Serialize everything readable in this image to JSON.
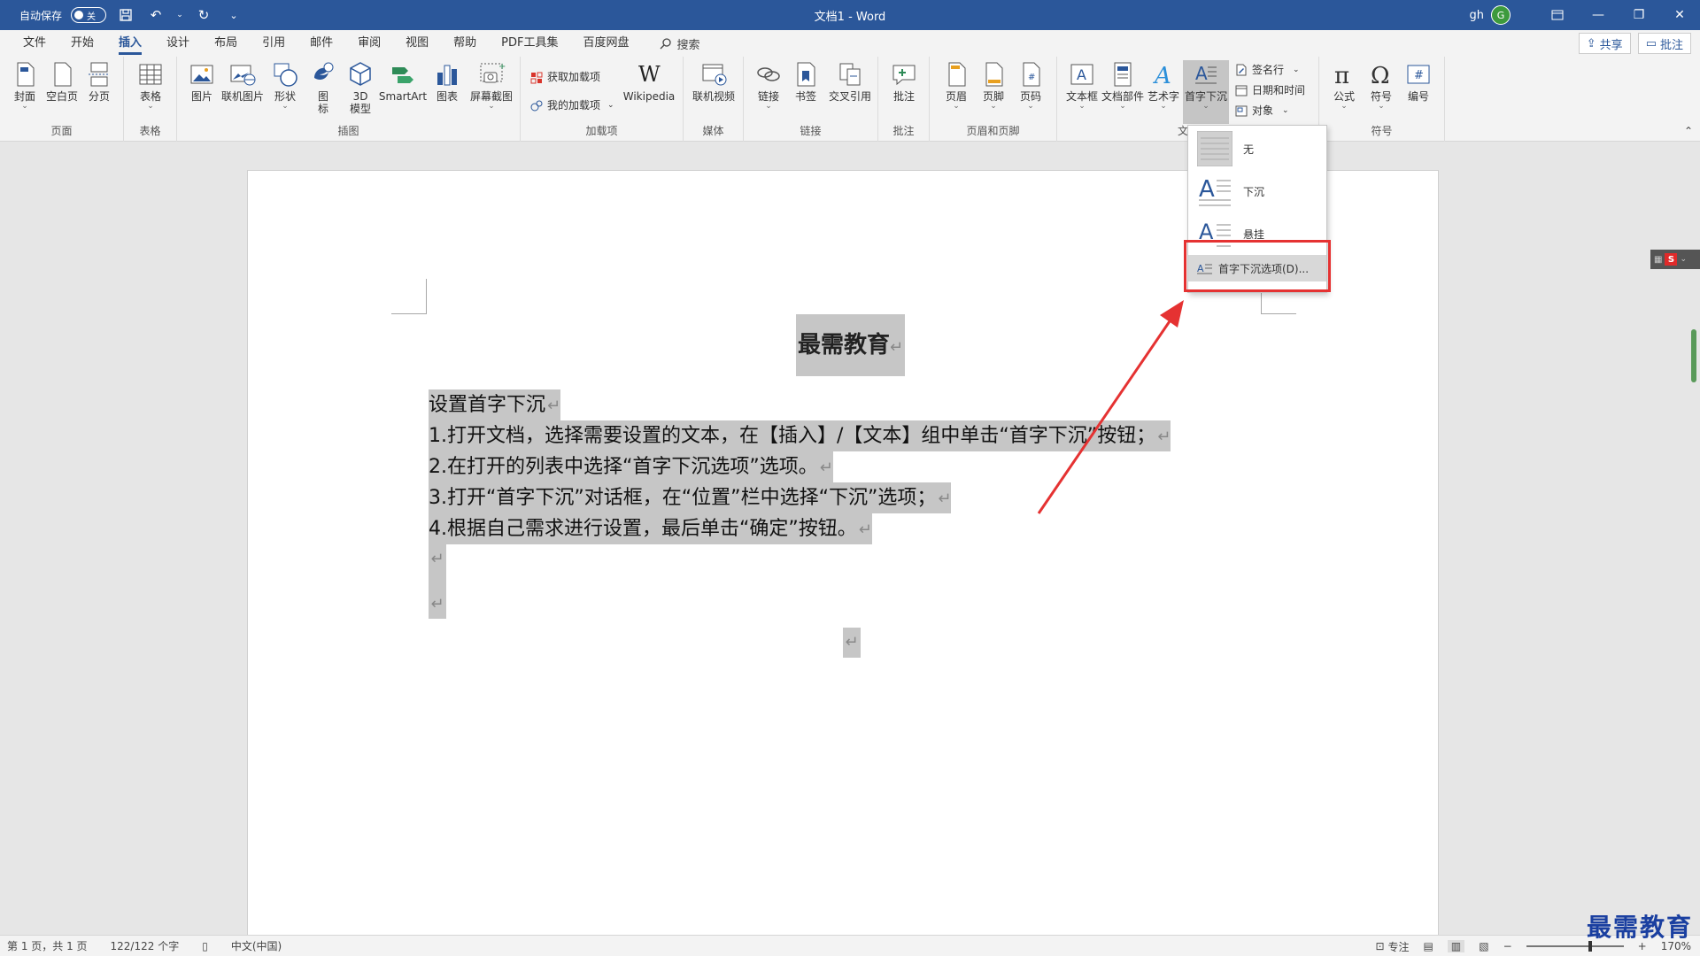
{
  "titlebar": {
    "autosave_label": "自动保存",
    "autosave_state": "关",
    "doc_title": "文档1 - Word",
    "user": "gh",
    "avatar_letter": "G"
  },
  "menu": {
    "tabs": [
      "文件",
      "开始",
      "插入",
      "设计",
      "布局",
      "引用",
      "邮件",
      "审阅",
      "视图",
      "帮助",
      "PDF工具集",
      "百度网盘"
    ],
    "active_tab": "插入",
    "search": "搜索",
    "share": "共享",
    "comment": "批注"
  },
  "ribbon": {
    "page": {
      "label": "页面",
      "cover": "封面",
      "blank": "空白页",
      "break": "分页"
    },
    "table": {
      "label": "表格",
      "table": "表格"
    },
    "illustrations": {
      "label": "插图",
      "picture": "图片",
      "online_picture": "联机图片",
      "shapes": "形状",
      "icons_1": "图",
      "icons_2": "标",
      "model_1": "3D",
      "model_2": "模型",
      "smartart": "SmartArt",
      "chart": "图表",
      "screenshot": "屏幕截图"
    },
    "addins": {
      "label": "加载项",
      "get": "获取加载项",
      "my": "我的加载项",
      "wikipedia": "Wikipedia"
    },
    "media": {
      "label": "媒体",
      "video": "联机视频"
    },
    "links": {
      "label": "链接",
      "link": "链接",
      "bookmark": "书签",
      "crossref": "交叉引用"
    },
    "comments": {
      "label": "批注",
      "comment": "批注"
    },
    "header_footer": {
      "label": "页眉和页脚",
      "header": "页眉",
      "footer": "页脚",
      "page_number": "页码"
    },
    "text": {
      "label": "文",
      "textbox": "文本框",
      "parts": "文档部件",
      "wordart": "艺术字",
      "dropcap": "首字下沉",
      "signature": "签名行",
      "datetime": "日期和时间",
      "object": "对象"
    },
    "symbols": {
      "label": "符号",
      "equation": "公式",
      "symbol": "符号",
      "number": "编号"
    }
  },
  "dropdown": {
    "none": "无",
    "dropped": "下沉",
    "margin": "悬挂",
    "options": "首字下沉选项(D)..."
  },
  "document": {
    "title": "最需教育",
    "mark": "↵",
    "lines": [
      "设置首字下沉",
      "1.打开文档，选择需要设置的文本，在【插入】/【文本】组中单击“首字下沉”按钮；",
      "2.在打开的列表中选择“首字下沉选项”选项。",
      "3.打开“首字下沉”对话框，在“位置”栏中选择“下沉”选项；",
      "4.根据自己需求进行设置，最后单击“确定”按钮。"
    ]
  },
  "statusbar": {
    "page": "第 1 页，共 1 页",
    "words": "122/122 个字",
    "language": "中文(中国)",
    "focus": "专注",
    "zoom": "170%"
  },
  "watermark": "最需教育",
  "colors": {
    "brand": "#2b579a",
    "highlight": "#e53232"
  }
}
